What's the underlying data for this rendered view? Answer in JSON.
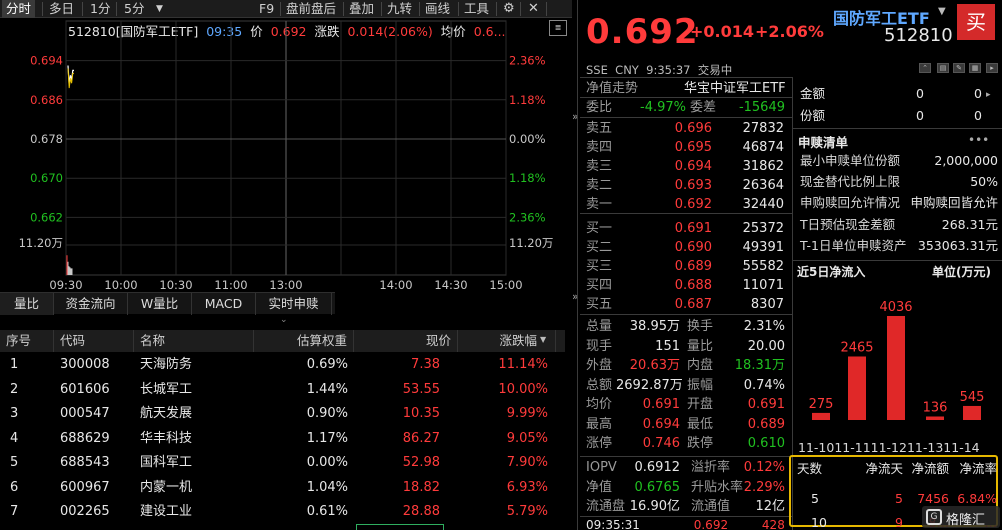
{
  "toolbar": {
    "left_tabs": [
      "分时",
      "多日",
      "1分",
      "5分"
    ],
    "right_items": [
      "F9",
      "盘前盘后",
      "叠加",
      "九转",
      "画线",
      "工具"
    ]
  },
  "chart_info": {
    "code_name": "512810[国防军工ETF]",
    "time": "09:35",
    "price_label": "价",
    "price": "0.692",
    "change_label": "涨跌",
    "change": "0.014(2.06%)",
    "avg_label": "均价",
    "avg": "0.6..."
  },
  "chart_data": {
    "type": "line",
    "y_left_ticks": [
      "0.694",
      "0.686",
      "0.678",
      "0.670",
      "0.662"
    ],
    "y_right_ticks": [
      "2.36%",
      "1.18%",
      "0.00%",
      "1.18%",
      "2.36%"
    ],
    "volume_label_left": "11.20万",
    "volume_label_right": "11.20万",
    "x_ticks": [
      "09:30",
      "10:00",
      "10:30",
      "11:00",
      "13:00",
      "14:00",
      "14:30",
      "15:00"
    ],
    "prev_close": 0.678,
    "ylim": [
      0.658,
      0.698
    ],
    "price_points": [
      [
        0,
        0.693
      ],
      [
        1,
        0.689
      ],
      [
        2,
        0.691
      ],
      [
        3,
        0.69
      ],
      [
        4,
        0.692
      ],
      [
        5,
        0.692
      ]
    ],
    "volume_points": [
      0.9,
      0.6,
      0.4,
      0.35,
      0.3,
      0.3
    ]
  },
  "bottom_tabs": [
    "量比",
    "资金流向",
    "W量比",
    "MACD",
    "实时申赎"
  ],
  "table": {
    "headers": [
      "序号",
      "代码",
      "名称",
      "估算权重",
      "现价",
      "涨跌幅"
    ],
    "rows": [
      {
        "no": "1",
        "code": "300008",
        "name": "天海防务",
        "weight": "0.69%",
        "price": "7.38",
        "pct": "11.14%"
      },
      {
        "no": "2",
        "code": "601606",
        "name": "长城军工",
        "weight": "1.44%",
        "price": "53.55",
        "pct": "10.00%"
      },
      {
        "no": "3",
        "code": "000547",
        "name": "航天发展",
        "weight": "0.90%",
        "price": "10.35",
        "pct": "9.99%"
      },
      {
        "no": "4",
        "code": "688629",
        "name": "华丰科技",
        "weight": "1.17%",
        "price": "86.27",
        "pct": "9.05%"
      },
      {
        "no": "5",
        "code": "688543",
        "name": "国科军工",
        "weight": "0.00%",
        "price": "52.98",
        "pct": "7.90%"
      },
      {
        "no": "6",
        "code": "600967",
        "name": "内蒙一机",
        "weight": "1.04%",
        "price": "18.82",
        "pct": "6.93%"
      },
      {
        "no": "7",
        "code": "002265",
        "name": "建设工业",
        "weight": "0.61%",
        "price": "28.88",
        "pct": "5.79%"
      }
    ]
  },
  "quote": {
    "price": "0.692",
    "change": "+0.014",
    "change_pct": "+2.06%",
    "name": "国防军工ETF",
    "code": "512810",
    "buy_label": "买",
    "market_line": "SSE  CNY  9:35:37  交易中",
    "nav_trend": "净值走势",
    "index_name": "华宝中证军工ETF",
    "wb_label": "委比",
    "wb_value": "-4.97%",
    "wc_label": "委差",
    "wc_value": "-15649",
    "asks": [
      {
        "label": "卖五",
        "price": "0.696",
        "vol": "27832"
      },
      {
        "label": "卖四",
        "price": "0.695",
        "vol": "46874"
      },
      {
        "label": "卖三",
        "price": "0.694",
        "vol": "31862"
      },
      {
        "label": "卖二",
        "price": "0.693",
        "vol": "26364"
      },
      {
        "label": "卖一",
        "price": "0.692",
        "vol": "32440"
      }
    ],
    "bids": [
      {
        "label": "买一",
        "price": "0.691",
        "vol": "25372"
      },
      {
        "label": "买二",
        "price": "0.690",
        "vol": "49391"
      },
      {
        "label": "买三",
        "price": "0.689",
        "vol": "55582"
      },
      {
        "label": "买四",
        "price": "0.688",
        "vol": "11071"
      },
      {
        "label": "买五",
        "price": "0.687",
        "vol": "8307"
      }
    ],
    "stats": [
      {
        "l1": "总量",
        "v1": "38.95万",
        "c1": "white",
        "l2": "换手",
        "v2": "2.31%",
        "c2": "white"
      },
      {
        "l1": "现手",
        "v1": "151",
        "c1": "white",
        "l2": "量比",
        "v2": "20.00",
        "c2": "white"
      },
      {
        "l1": "外盘",
        "v1": "20.63万",
        "c1": "red",
        "l2": "内盘",
        "v2": "18.31万",
        "c2": "green"
      },
      {
        "l1": "总额",
        "v1": "2692.87万",
        "c1": "white",
        "l2": "振幅",
        "v2": "0.74%",
        "c2": "white"
      },
      {
        "l1": "均价",
        "v1": "0.691",
        "c1": "red",
        "l2": "开盘",
        "v2": "0.691",
        "c2": "red"
      },
      {
        "l1": "最高",
        "v1": "0.694",
        "c1": "red",
        "l2": "最低",
        "v2": "0.689",
        "c2": "red"
      },
      {
        "l1": "涨停",
        "v1": "0.746",
        "c1": "red",
        "l2": "跌停",
        "v2": "0.610",
        "c2": "green"
      }
    ],
    "stats2": [
      {
        "l1": "IOPV",
        "v1": "0.6912",
        "c1": "white",
        "l2": "溢折率",
        "v2": "0.12%",
        "c2": "red"
      },
      {
        "l1": "净值",
        "v1": "0.6765",
        "c1": "green",
        "l2": "升贴水率",
        "v2": "2.29%",
        "c2": "red"
      },
      {
        "l1": "流通盘",
        "v1": "16.90亿",
        "c1": "white",
        "l2": "流通值",
        "v2": "12亿",
        "c2": "white"
      }
    ],
    "last_line": {
      "time": "09:35:31",
      "price": "0.692",
      "vol": "428"
    }
  },
  "fund": {
    "top_rows": [
      {
        "label": "金额",
        "a": "0",
        "b": "0"
      },
      {
        "label": "份额",
        "a": "0",
        "b": "0"
      }
    ],
    "shengshu_title": "申赎清单",
    "items": [
      {
        "label": "最小申赎单位份额",
        "value": "2,000,000"
      },
      {
        "label": "现金替代比例上限",
        "value": "50%"
      },
      {
        "label": "申购赎回允许情况",
        "value": "申购赎回皆允许"
      },
      {
        "label": "T日预估现金差额",
        "value": "268.31元"
      },
      {
        "label": "T-1日单位申赎资产",
        "value": "353063.31元"
      }
    ],
    "flow_title": "近5日净流入",
    "flow_unit": "单位(万元)",
    "flow_table": {
      "headers": [
        "天数",
        "净流天",
        "净流额",
        "净流率"
      ],
      "rows": [
        {
          "days": "5",
          "net_days": "5",
          "amount": "7456",
          "rate": "6.84%"
        },
        {
          "days": "10",
          "net_days": "9",
          "amount": "8…",
          "rate": "…"
        }
      ]
    }
  },
  "flow_chart": {
    "type": "bar",
    "categories": [
      "11-10",
      "11-11",
      "11-12",
      "11-13",
      "11-14"
    ],
    "x_label_text": "11-1011-1111-1211-1311-14",
    "values": [
      275,
      2465,
      4036,
      136,
      545
    ],
    "color": "#e02828"
  },
  "watermark": "格隆汇"
}
